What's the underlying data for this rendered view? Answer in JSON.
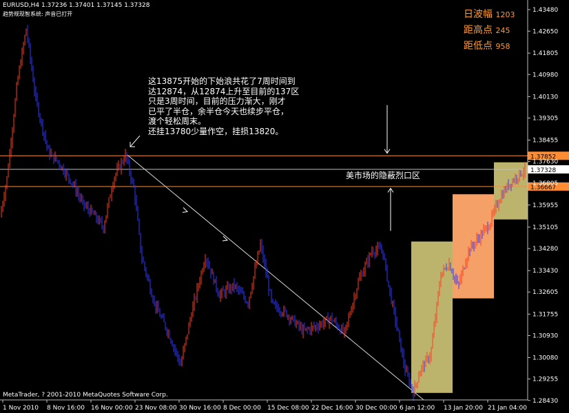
{
  "header": {
    "symbol_line": "EURUSD,H4  1.37236 1.37401 1.37145 1.37328",
    "indicator_line": "趋势规现智系统: 声音已打开"
  },
  "stats": {
    "range_label": "日波幅",
    "range_value": "1203",
    "from_high_label": "距高点",
    "from_high_value": "245",
    "from_low_label": "距低点",
    "from_low_value": "958"
  },
  "annotation": {
    "text": "这13875开始的下始浪共花了7周时间到\n达12874，从12874上升至目前的137区\n只是3周时间，目前的压力渐大，刚才\n已平了半仓，余半仓今天也续步平仓，\n渡个轻松周末。\n还挂13780少量作空，挂损13820。",
    "zone_label": "美市场的隐蔽烈口区"
  },
  "footer": {
    "copyright": "MetaTrader, ? 2001-2010 MetaQuotes Software Corp."
  },
  "chart_data": {
    "type": "candlestick",
    "symbol": "EURUSD",
    "timeframe": "H4",
    "ylim": [
      1.2845,
      1.4385
    ],
    "y_ticks": [
      "1.43480",
      "1.42650",
      "1.41805",
      "1.40980",
      "1.40130",
      "1.39305",
      "1.38455",
      "1.37630",
      "1.36805",
      "1.35955",
      "1.35105",
      "1.34280",
      "1.33430",
      "1.32605",
      "1.31755",
      "1.30930",
      "1.30080",
      "1.29255",
      "1.28430"
    ],
    "x_ticks": [
      "1 Nov 2010",
      "8 Nov 16:00",
      "16 Nov 00:00",
      "23 Nov 08:00",
      "30 Nov 16:00",
      "8 Dec 00:00",
      "15 Dec 08:00",
      "22 Dec 16:00",
      "30 Dec 00:00",
      "6 Jan 12:00",
      "13 Jan 20:00",
      "21 Jan 04:00"
    ],
    "price_levels": [
      {
        "value": 1.37852,
        "label": "1.37852",
        "color": "#ff8c32"
      },
      {
        "value": 1.37328,
        "label": "1.37328",
        "color": "#c0c0c0"
      },
      {
        "value": 1.36667,
        "label": "1.36667",
        "color": "#ff8c32"
      }
    ],
    "anchors": [
      [
        0,
        1.355
      ],
      [
        10,
        1.37
      ],
      [
        25,
        1.407
      ],
      [
        38,
        1.4275
      ],
      [
        52,
        1.4
      ],
      [
        70,
        1.38
      ],
      [
        85,
        1.376
      ],
      [
        105,
        1.368
      ],
      [
        120,
        1.36
      ],
      [
        135,
        1.356
      ],
      [
        150,
        1.351
      ],
      [
        165,
        1.37
      ],
      [
        182,
        1.3788
      ],
      [
        195,
        1.365
      ],
      [
        205,
        1.34
      ],
      [
        225,
        1.321
      ],
      [
        245,
        1.31
      ],
      [
        262,
        1.298
      ],
      [
        278,
        1.318
      ],
      [
        298,
        1.34
      ],
      [
        318,
        1.325
      ],
      [
        340,
        1.3285
      ],
      [
        360,
        1.322
      ],
      [
        378,
        1.3445
      ],
      [
        395,
        1.321
      ],
      [
        415,
        1.318
      ],
      [
        440,
        1.311
      ],
      [
        460,
        1.313
      ],
      [
        480,
        1.316
      ],
      [
        500,
        1.31
      ],
      [
        520,
        1.33
      ],
      [
        540,
        1.342
      ],
      [
        555,
        1.3425
      ],
      [
        565,
        1.327
      ],
      [
        575,
        1.314
      ],
      [
        588,
        1.296
      ],
      [
        600,
        1.2874
      ],
      [
        610,
        1.296
      ],
      [
        625,
        1.302
      ],
      [
        640,
        1.333
      ],
      [
        652,
        1.337
      ],
      [
        665,
        1.328
      ],
      [
        680,
        1.342
      ],
      [
        695,
        1.347
      ],
      [
        710,
        1.352
      ],
      [
        725,
        1.362
      ],
      [
        740,
        1.368
      ],
      [
        752,
        1.371
      ],
      [
        763,
        1.3733
      ]
    ],
    "trendline": {
      "from": [
        185,
        1.3788
      ],
      "to": [
        615,
        1.2845
      ]
    },
    "arrows": [
      {
        "x": 272,
        "y": 1.357,
        "dir": "down-right"
      },
      {
        "x": 330,
        "y": 1.346,
        "dir": "down-right"
      },
      {
        "x": 562,
        "y": 1.3795,
        "dir": "down"
      },
      {
        "x": 567,
        "y": 1.366,
        "dir": "up"
      },
      {
        "x": 189,
        "y": 1.382,
        "dir": "up-right"
      }
    ],
    "zones": [
      {
        "x0": 597,
        "x1": 657,
        "y0": 1.2872,
        "y1": 1.3455,
        "color": "#bcb46c"
      },
      {
        "x0": 657,
        "x1": 717,
        "y0": 1.3236,
        "y1": 1.3637,
        "color": "#f4a066"
      },
      {
        "x0": 717,
        "x1": 766,
        "y0": 1.354,
        "y1": 1.376,
        "color": "#bcb46c"
      }
    ],
    "up_color": "#ff3d1f",
    "down_color": "#2f38ff"
  }
}
